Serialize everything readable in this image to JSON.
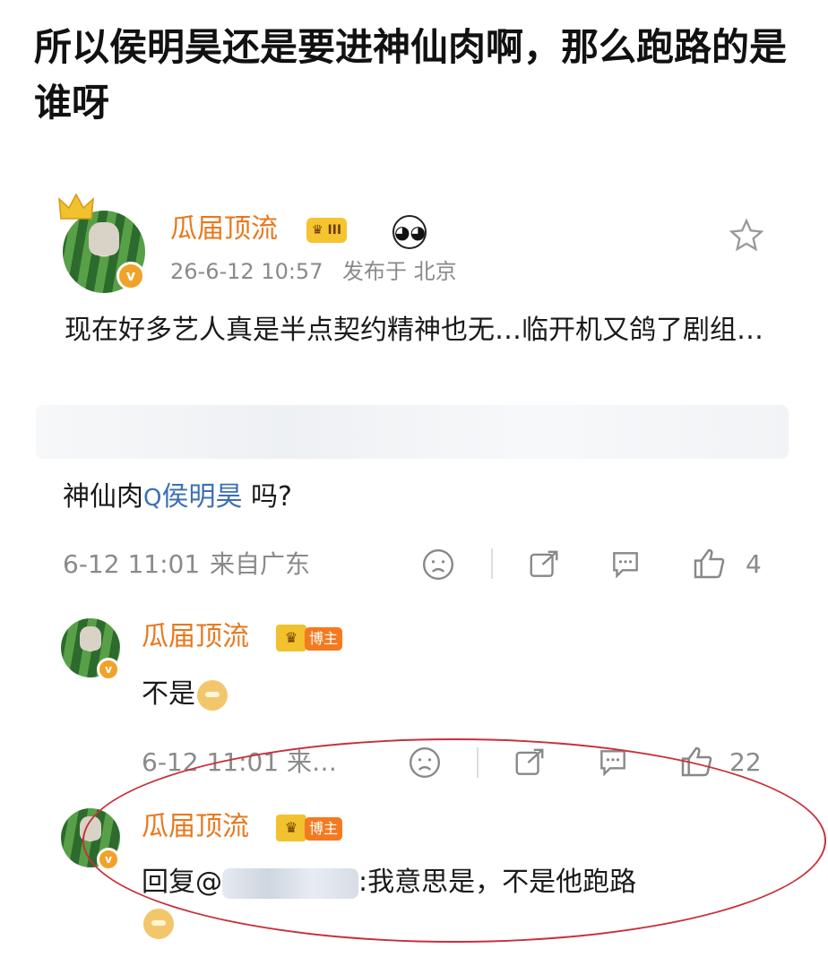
{
  "headline": "所以侯明昊还是要进神仙肉啊，那么跑路的是谁呀",
  "post": {
    "username": "瓜届顶流",
    "level_badge": "III",
    "timestamp": "26-6-12 10:57",
    "location": "发布于 北京",
    "body": "现在好多艺人真是半点契约精神也无…临开机又鸽了剧组…"
  },
  "comment": {
    "prefix": "神仙肉",
    "mention": "侯明昊",
    "suffix": " 吗?",
    "time": "6-12 11:01",
    "source": "来自广东",
    "like_count": "4"
  },
  "reply1": {
    "username": "瓜届顶流",
    "badge": "博主",
    "text": "不是",
    "time": "6-12 11:01 来…",
    "like_count": "22"
  },
  "reply2": {
    "username": "瓜届顶流",
    "badge": "博主",
    "prefix": "回复@",
    "suffix": ":我意思是，不是他跑路"
  },
  "colors": {
    "name": "#e8781e",
    "link": "#3c6fb5",
    "accent": "#f1a22a",
    "annotation": "#c8303a"
  }
}
